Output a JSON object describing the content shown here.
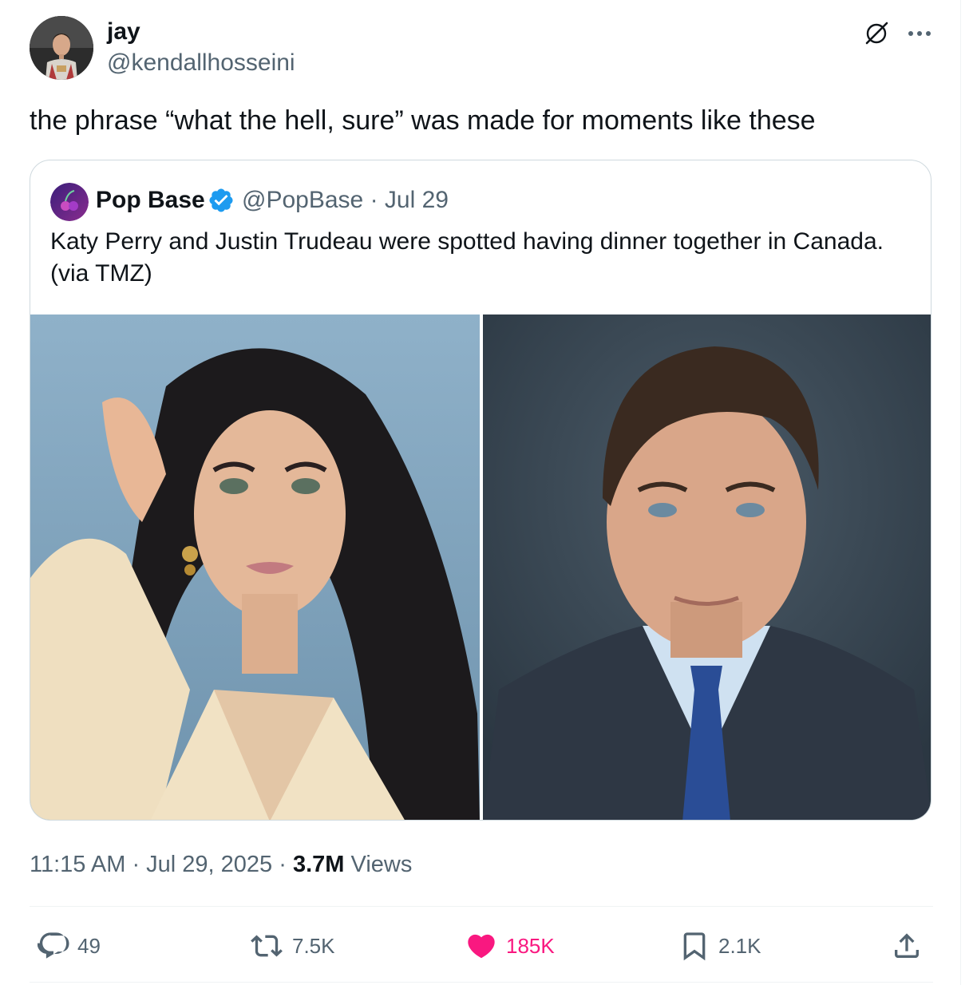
{
  "tweet": {
    "display_name": "jay",
    "handle": "@kendallhosseini",
    "text": "the phrase “what the hell, sure” was made for moments like these",
    "avatar_icon": "user-avatar",
    "grok_icon": "grok-icon",
    "more_icon": "more-horizontal-icon"
  },
  "quote": {
    "display_name": "Pop Base",
    "handle": "@PopBase",
    "date": "· Jul 29",
    "verified_color": "#1d9bf0",
    "text": "Katy Perry and Justin Trudeau were spotted having dinner together in Canada. (via TMZ)",
    "images": [
      {
        "alt_icon": "photo-woman"
      },
      {
        "alt_icon": "photo-man"
      }
    ]
  },
  "meta": {
    "time": "11:15 AM",
    "sep1": " · ",
    "date": "Jul 29, 2025",
    "sep2": " · ",
    "views_count": "3.7M",
    "views_label": " Views"
  },
  "actions": {
    "replies": "49",
    "reposts": "7.5K",
    "likes": "185K",
    "bookmarks": "2.1K",
    "like_color": "#f91880",
    "muted_color": "#536471"
  }
}
